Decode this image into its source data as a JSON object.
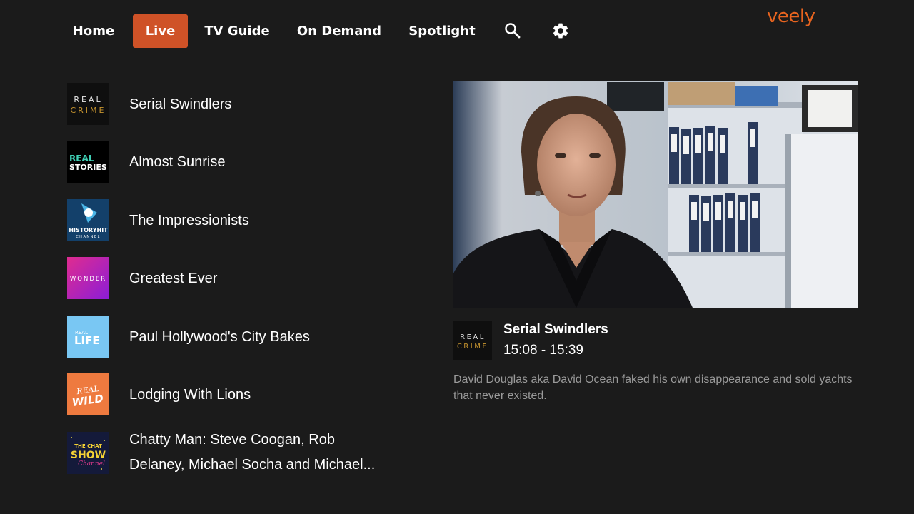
{
  "nav": {
    "items": [
      {
        "label": "Home",
        "active": false
      },
      {
        "label": "Live",
        "active": true
      },
      {
        "label": "TV Guide",
        "active": false
      },
      {
        "label": "On Demand",
        "active": false
      },
      {
        "label": "Spotlight",
        "active": false
      }
    ],
    "icons": [
      "search-icon",
      "gear-icon"
    ],
    "brand": "veely",
    "accent_color": "#cf5227",
    "brand_color": "#e8641f"
  },
  "channels": [
    {
      "logo_text": [
        "REAL",
        "CRIME"
      ],
      "title": "Serial Swindlers"
    },
    {
      "logo_text": [
        "REAL",
        "STORIES"
      ],
      "title": "Almost Sunrise"
    },
    {
      "logo_text": [
        "HISTORYHIT",
        "CHANNEL"
      ],
      "title": "The Impressionists"
    },
    {
      "logo_text": [
        "WONDER"
      ],
      "title": "Greatest Ever"
    },
    {
      "logo_text": [
        "REAL",
        "LIFE"
      ],
      "title": "Paul Hollywood's City Bakes"
    },
    {
      "logo_text": [
        "REAL",
        "WILD"
      ],
      "title": "Lodging With Lions"
    },
    {
      "logo_text": [
        "THE CHAT",
        "SHOW",
        "Channel"
      ],
      "title": "Chatty Man: Steve Coogan, Rob Delaney, Michael Socha and Michael..."
    }
  ],
  "detail": {
    "logo_text": [
      "REAL",
      "CRIME"
    ],
    "title": "Serial Swindlers",
    "time": "15:08 - 15:39",
    "description": "David Douglas aka David Ocean faked his own disappearance and sold yachts that never existed."
  }
}
